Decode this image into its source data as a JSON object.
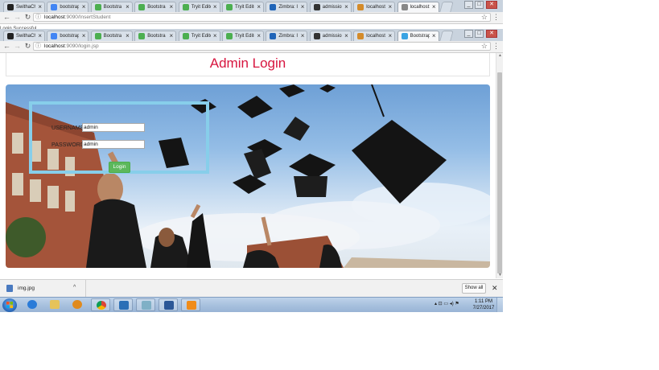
{
  "browser": {
    "tabs_row1": [
      {
        "label": "SwithaCh",
        "icon": "github-icon",
        "color": "#222222"
      },
      {
        "label": "bootstrap",
        "icon": "google-icon",
        "color": "#4285f4"
      },
      {
        "label": "Bootstra",
        "icon": "w3-icon",
        "color": "#4caf50"
      },
      {
        "label": "Bootstra",
        "icon": "w3-icon",
        "color": "#4caf50"
      },
      {
        "label": "Tryit Edito",
        "icon": "w3-icon",
        "color": "#4caf50"
      },
      {
        "label": "Tryit Edito",
        "icon": "w3-icon",
        "color": "#4caf50"
      },
      {
        "label": "Zimbra: In",
        "icon": "zimbra-icon",
        "color": "#1f64b8"
      },
      {
        "label": "admission",
        "icon": "download-icon",
        "color": "#333333"
      },
      {
        "label": "localhost:",
        "icon": "tomcat-icon",
        "color": "#d48b2a"
      },
      {
        "label": "localhost:",
        "icon": "page-icon",
        "color": "#888888",
        "active": true
      }
    ],
    "tabs_row2": [
      {
        "label": "SwithaCh",
        "icon": "github-icon",
        "color": "#222222"
      },
      {
        "label": "bootstrap",
        "icon": "google-icon",
        "color": "#4285f4"
      },
      {
        "label": "Bootstra",
        "icon": "w3-icon",
        "color": "#4caf50"
      },
      {
        "label": "Bootstra",
        "icon": "w3-icon",
        "color": "#4caf50"
      },
      {
        "label": "Tryit Edito",
        "icon": "w3-icon",
        "color": "#4caf50"
      },
      {
        "label": "Tryit Edito",
        "icon": "w3-icon",
        "color": "#4caf50"
      },
      {
        "label": "Zimbra: In",
        "icon": "zimbra-icon",
        "color": "#1f64b8"
      },
      {
        "label": "admission",
        "icon": "download-icon",
        "color": "#333333"
      },
      {
        "label": "localhost:",
        "icon": "tomcat-icon",
        "color": "#d48b2a"
      },
      {
        "label": "Bootstrap",
        "icon": "bootstrap-icon",
        "color": "#3aa3e3",
        "active": true
      }
    ],
    "url1": {
      "host": "localhost",
      "path": ":9090/InsertStudent"
    },
    "url2": {
      "host": "localhost",
      "path": ":9090/login.jsp"
    },
    "bleed_text": "Login Successful"
  },
  "page": {
    "title": "Admin Login",
    "username_label": "USERNAME",
    "username_value": "admin",
    "password_label": "PASSWORD",
    "password_value": "admin",
    "login_label": "Login",
    "accent_color": "#d7153f",
    "button_color": "#5cb85c",
    "frame_color": "#87ceea"
  },
  "downloads": {
    "file_name": "img.jpg",
    "show_all": "Show all"
  },
  "taskbar": {
    "time": "1:11 PM",
    "date": "7/27/2017"
  }
}
